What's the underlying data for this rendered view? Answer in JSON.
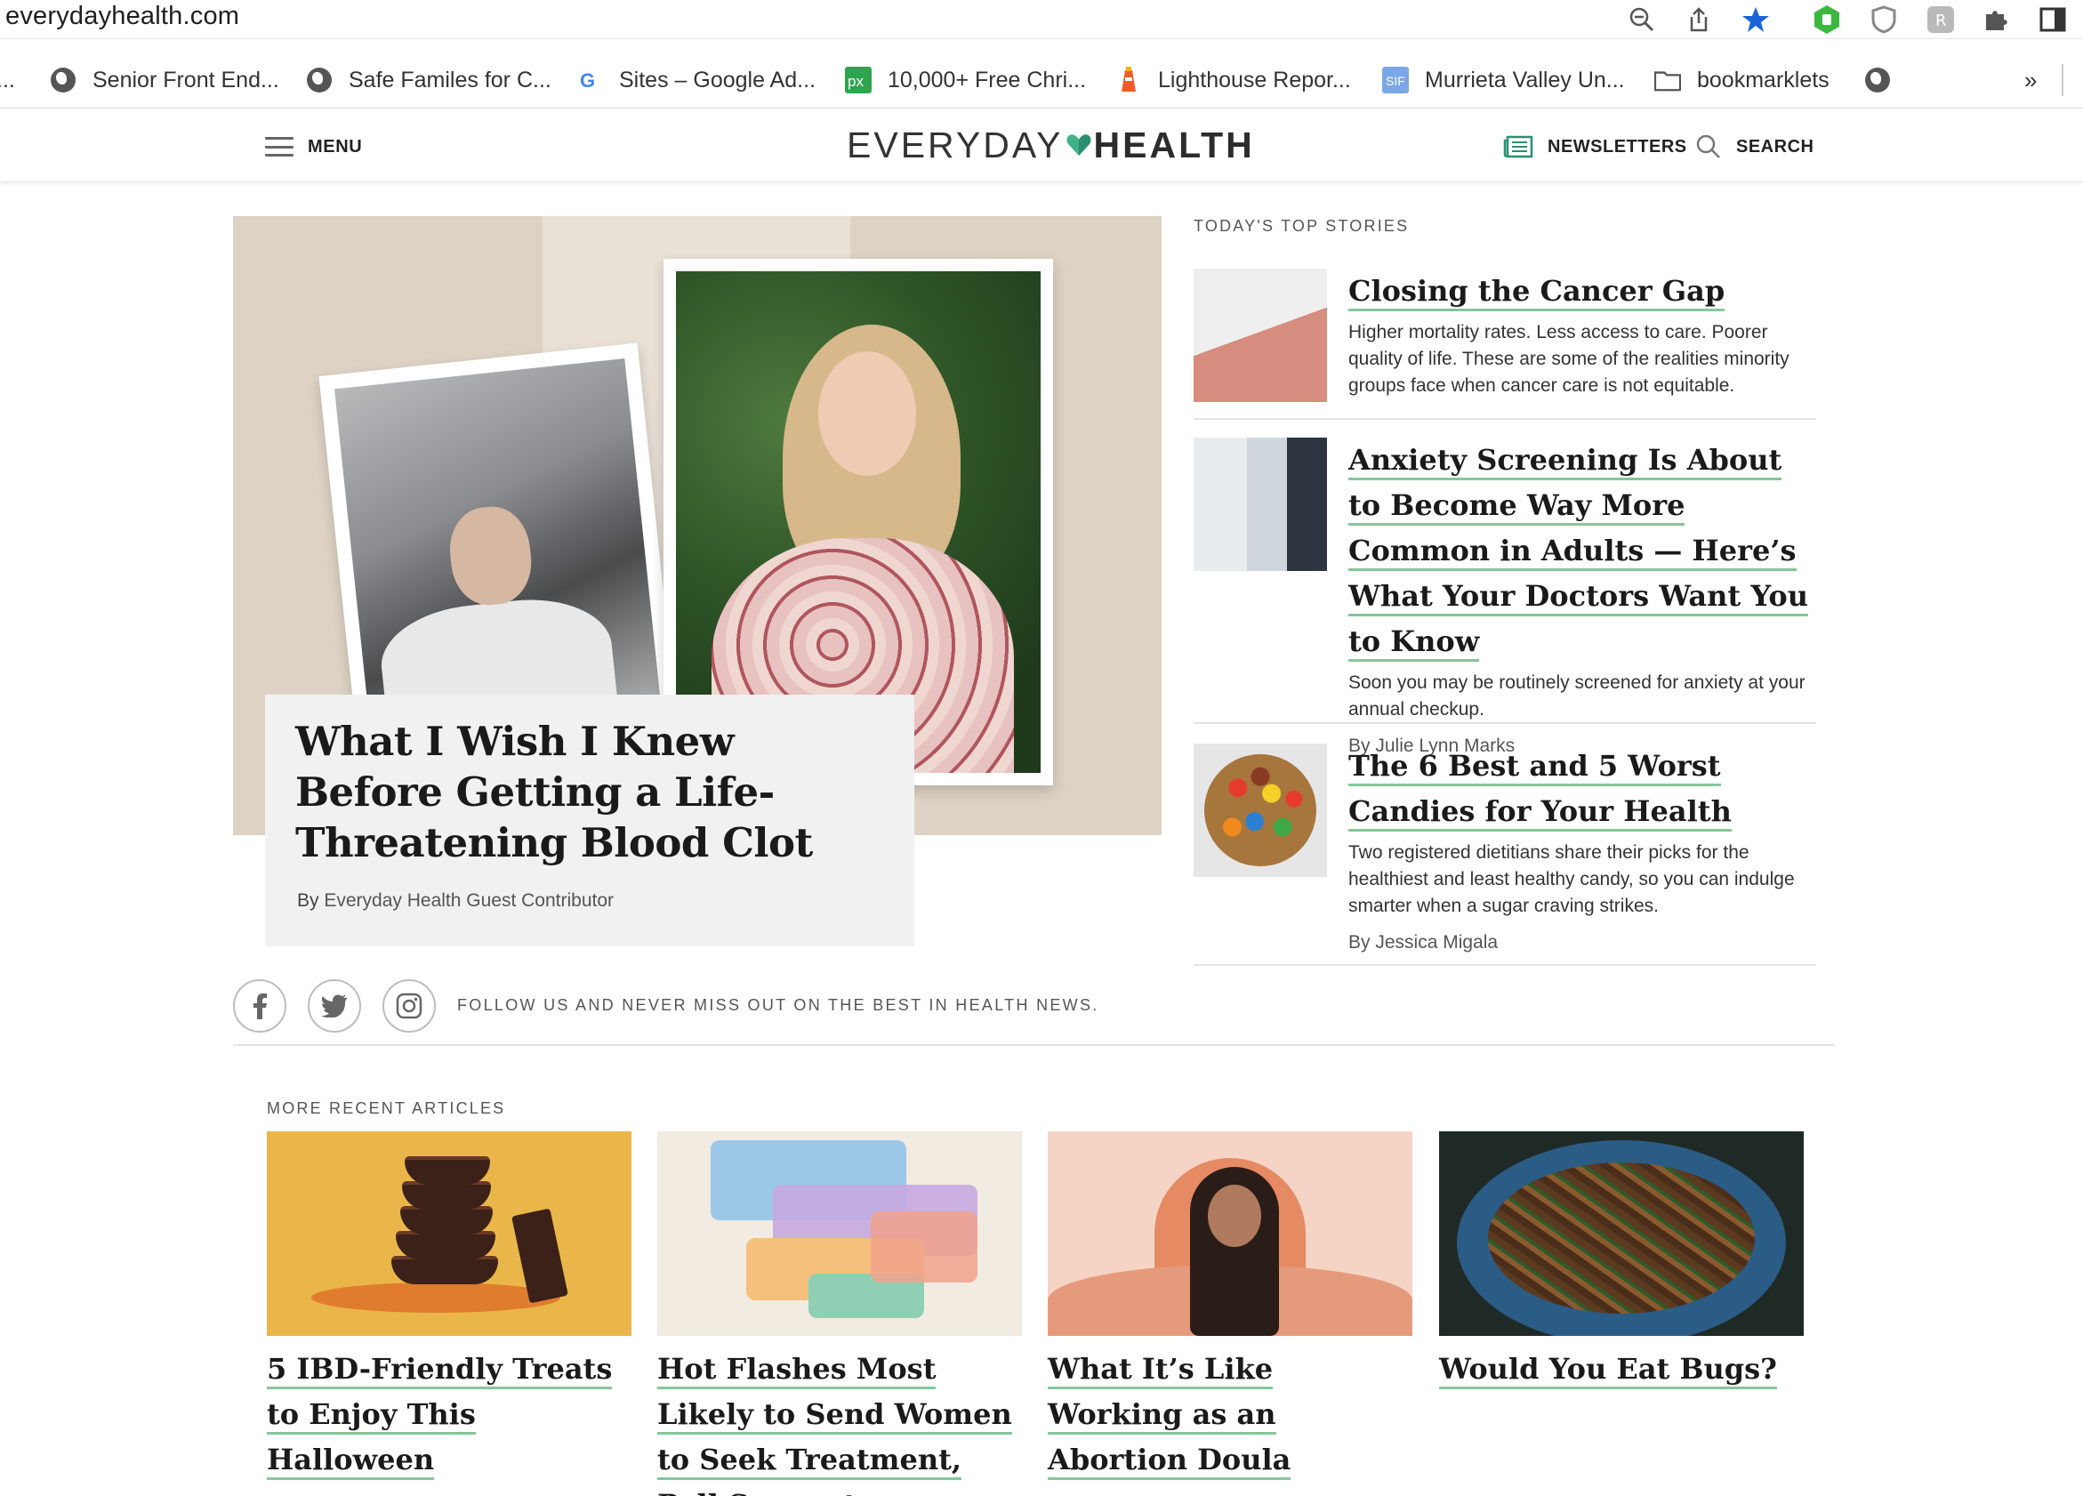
{
  "browser": {
    "url": "everydayhealth.com",
    "bookmarks": [
      {
        "label": "Senior Front End...",
        "icon": "globe-icon"
      },
      {
        "label": "Safe Familes for C...",
        "icon": "globe-icon"
      },
      {
        "label": "Sites – Google Ad...",
        "icon": "google-icon"
      },
      {
        "label": "10,000+ Free Chri...",
        "icon": "pixabay-icon"
      },
      {
        "label": "Lighthouse Repor...",
        "icon": "lighthouse-icon"
      },
      {
        "label": "Murrieta Valley Un...",
        "icon": "school-icon"
      },
      {
        "label": "bookmarklets",
        "icon": "folder-icon"
      }
    ],
    "overflow_label": "»"
  },
  "header": {
    "menu_label": "MENU",
    "logo_part1": "EVERYDAY",
    "logo_part2": "HEALTH",
    "newsletters_label": "NEWSLETTERS",
    "search_label": "SEARCH",
    "accent_color": "#3fb28a"
  },
  "hero": {
    "title": "What I Wish I Knew Before Getting a Life-Threatening Blood Clot",
    "byline_prefix": "By",
    "author": "Everyday Health Guest Contributor"
  },
  "top_stories": {
    "heading": "TODAY'S TOP STORIES",
    "items": [
      {
        "title": "Closing the Cancer Gap",
        "description": "Higher mortality rates. Less access to care. Poorer quality of life. These are some of the realities minority groups face when cancer care is not equitable.",
        "byline_prefix": "",
        "author": ""
      },
      {
        "title": "Anxiety Screening Is About to Become Way More Common in Adults — Here’s What Your Doctors Want You to Know",
        "description": "Soon you may be routinely screened for anxiety at your annual checkup.",
        "byline_prefix": "By",
        "author": "Julie Lynn Marks"
      },
      {
        "title": "The 6 Best and 5 Worst Candies for Your Health",
        "description": "Two registered dietitians share their picks for the healthiest and least healthy candy, so you can indulge smarter when a sugar craving strikes.",
        "byline_prefix": "By",
        "author": "Jessica Migala"
      }
    ]
  },
  "social": {
    "follow_text": "FOLLOW US AND NEVER MISS OUT ON THE BEST IN HEALTH NEWS.",
    "networks": [
      "facebook-icon",
      "twitter-icon",
      "instagram-icon"
    ]
  },
  "more_recent": {
    "heading": "MORE RECENT ARTICLES",
    "items": [
      {
        "title": "5 IBD-Friendly Treats to Enjoy This Halloween"
      },
      {
        "title": "Hot Flashes Most Likely to Send Women to Seek Treatment, Poll Suggests"
      },
      {
        "title": "What It’s Like Working as an Abortion Doula"
      },
      {
        "title": "Would You Eat Bugs?"
      }
    ]
  },
  "colors": {
    "link_underline": "#84c79a",
    "card_bg": "#f1f1f1"
  }
}
